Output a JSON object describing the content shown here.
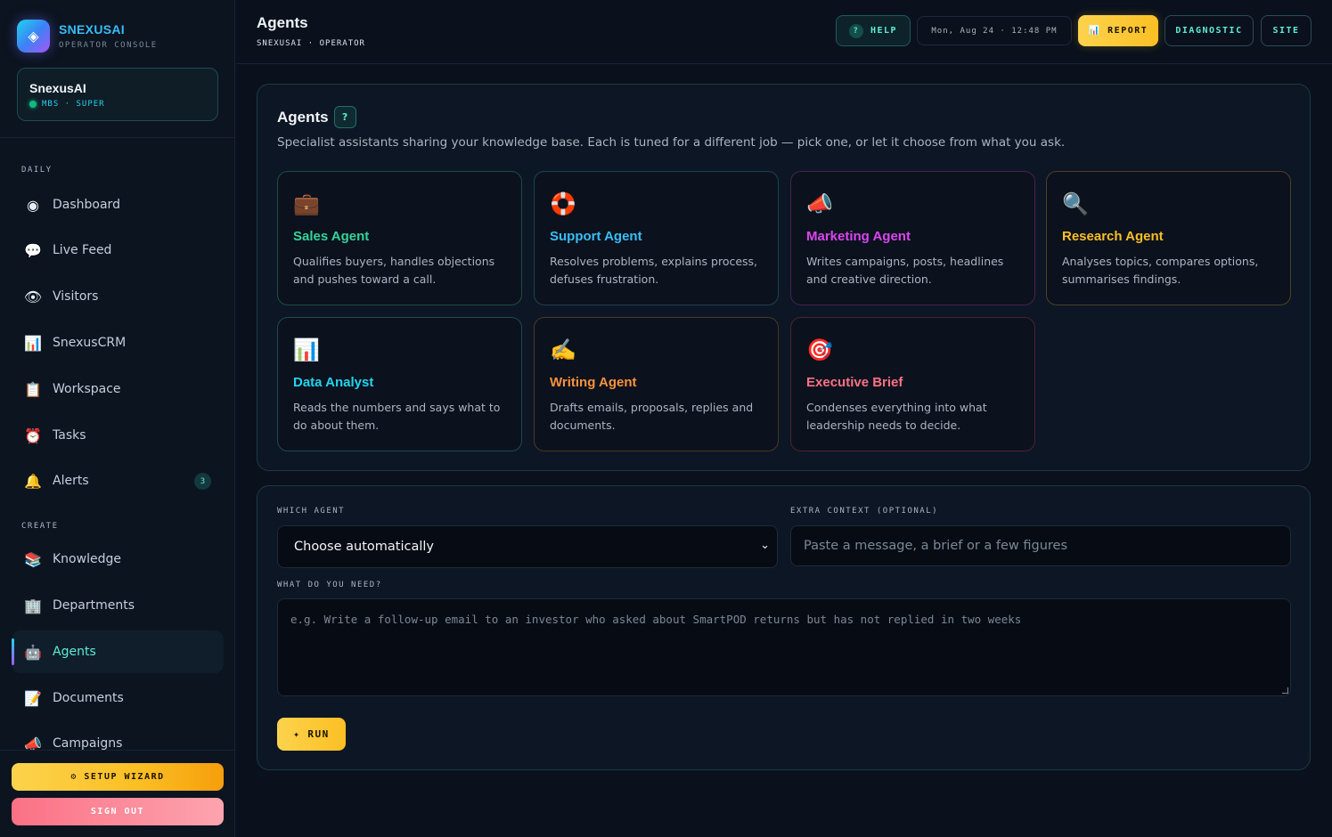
{
  "brand": {
    "name": "SNEXUSAI",
    "subtitle": "OPERATOR CONSOLE"
  },
  "account": {
    "name": "SnexusAI",
    "role": "MBS · SUPER"
  },
  "nav": {
    "sections": {
      "daily": "DAILY",
      "create": "CREATE"
    },
    "daily": [
      {
        "icon": "◉",
        "label": "Dashboard"
      },
      {
        "icon": "💬",
        "label": "Live Feed"
      },
      {
        "icon": "👁",
        "label": "Visitors"
      },
      {
        "icon": "📊",
        "label": "SnexusCRM"
      },
      {
        "icon": "📋",
        "label": "Workspace"
      },
      {
        "icon": "⏰",
        "label": "Tasks"
      },
      {
        "icon": "🔔",
        "label": "Alerts",
        "badge": "3"
      }
    ],
    "create": [
      {
        "icon": "📚",
        "label": "Knowledge"
      },
      {
        "icon": "🏢",
        "label": "Departments"
      },
      {
        "icon": "🤖",
        "label": "Agents",
        "active": true
      },
      {
        "icon": "📝",
        "label": "Documents"
      },
      {
        "icon": "📣",
        "label": "Campaigns"
      }
    ]
  },
  "sidebar_footer": {
    "wizard": "⚙ SETUP WIZARD",
    "signout": "SIGN OUT"
  },
  "header": {
    "title": "Agents",
    "subtitle": "SNEXUSAI · OPERATOR",
    "help": "HELP",
    "help_q": "?",
    "clock": "Mon, Aug 24 · 12:48 PM",
    "report": "📊 REPORT",
    "diagnostic": "DIAGNOSTIC",
    "site": "SITE"
  },
  "agents_panel": {
    "title": "Agents",
    "help_q": "?",
    "description": "Specialist assistants sharing your knowledge base. Each is tuned for a different job — pick one, or let it choose from what you ask.",
    "cards": [
      {
        "icon": "💼",
        "name": "Sales Agent",
        "desc": "Qualifies buyers, handles objections and pushes toward a call.",
        "color": "#34d399",
        "border": "#1d4d45"
      },
      {
        "icon": "🛟",
        "name": "Support Agent",
        "desc": "Resolves problems, explains process, defuses frustration.",
        "color": "#38bdf8",
        "border": "#1d4256"
      },
      {
        "icon": "📣",
        "name": "Marketing Agent",
        "desc": "Writes campaigns, posts, headlines and creative direction.",
        "color": "#d946ef",
        "border": "#4a1f55"
      },
      {
        "icon": "🔍",
        "name": "Research Agent",
        "desc": "Analyses topics, compares options, summarises findings.",
        "color": "#fbbf24",
        "border": "#4d4128"
      },
      {
        "icon": "📊",
        "name": "Data Analyst",
        "desc": "Reads the numbers and says what to do about them.",
        "color": "#22d3ee",
        "border": "#1d4a52"
      },
      {
        "icon": "✍️",
        "name": "Writing Agent",
        "desc": "Drafts emails, proposals, replies and documents.",
        "color": "#fb923c",
        "border": "#4d3622"
      },
      {
        "icon": "🎯",
        "name": "Executive Brief",
        "desc": "Condenses everything into what leadership needs to decide.",
        "color": "#fb7185",
        "border": "#4d2230"
      }
    ]
  },
  "form": {
    "which_label": "WHICH AGENT",
    "which_value": "Choose automatically",
    "context_label": "EXTRA CONTEXT (OPTIONAL)",
    "context_placeholder": "Paste a message, a brief or a few figures",
    "need_label": "WHAT DO YOU NEED?",
    "need_placeholder": "e.g. Write a follow-up email to an investor who asked about SmartPOD returns but has not replied in two weeks",
    "run": "✦ RUN"
  }
}
